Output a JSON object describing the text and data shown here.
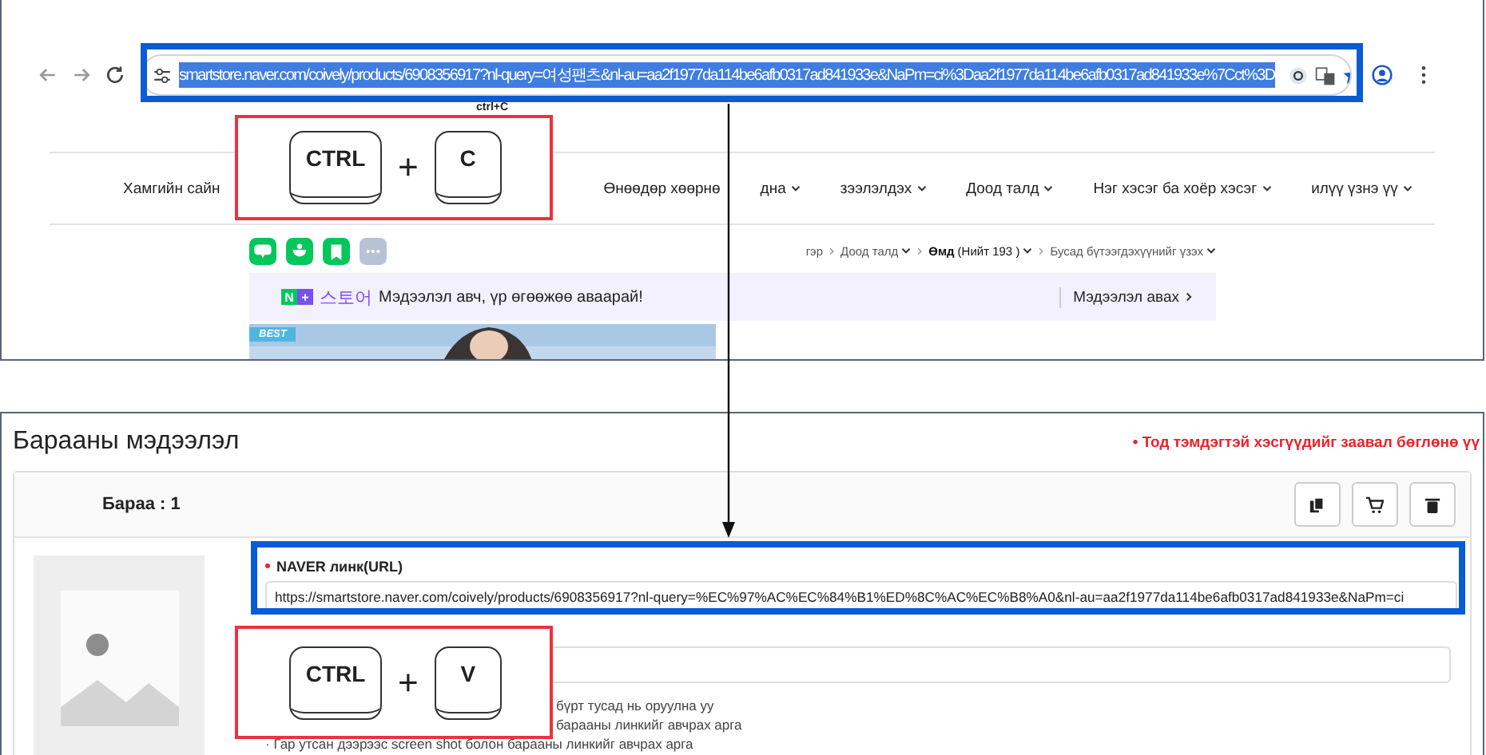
{
  "browser": {
    "address": "smartstore.naver.com/coively/products/6908356917?nl-query=여성팬츠&nl-au=aa2f1977da114be6afb0317ad841933e&NaPm=ci%3Daa2f1977da114be6afb0317ad841933e%7Cct%3D",
    "selected": true
  },
  "annotations": {
    "copy_hint": "ctrl+C",
    "copy_keys": [
      {
        "kind": "key",
        "label": "CTRL"
      },
      {
        "kind": "plus",
        "label": "+"
      },
      {
        "kind": "key",
        "label": "C"
      }
    ],
    "paste_keys": [
      {
        "kind": "key",
        "label": "CTRL"
      },
      {
        "kind": "plus",
        "label": "+"
      },
      {
        "kind": "key",
        "label": "V"
      }
    ]
  },
  "store_page": {
    "nav": [
      {
        "label": "Хамгийн сайн",
        "dropdown": false
      },
      {
        "label": "Өнөөдөр хөөрнө",
        "dropdown": false
      },
      {
        "label": "дна",
        "dropdown": true
      },
      {
        "label": "зээлэлдэх",
        "dropdown": true
      },
      {
        "label": "Доод талд",
        "dropdown": true
      },
      {
        "label": "Нэг хэсэг ба хоёр хэсэг",
        "dropdown": true
      },
      {
        "label": "илүү үзнэ үү",
        "dropdown": true
      }
    ],
    "breadcrumb": [
      {
        "label": "гэр",
        "selected": false,
        "dropdown": false
      },
      {
        "label": "Доод талд",
        "selected": false,
        "dropdown": true
      },
      {
        "label": "Өмд",
        "count": "(Нийт 193 )",
        "selected": true,
        "dropdown": true
      },
      {
        "label": "Бусад бүтээгдэхүүнийг үзэх",
        "selected": false,
        "dropdown": true
      }
    ],
    "banner": {
      "logo": [
        {
          "char": "N",
          "color": "#03c75a"
        },
        {
          "char": "+",
          "color": "#7b4ff0"
        }
      ],
      "store": "스토어",
      "message": "Мэдээлэл авч, үр өгөөжөө аваарай!",
      "link": "Мэдээлэл авах"
    },
    "photo": {
      "kind": "picture",
      "badge": "BEST"
    }
  },
  "form": {
    "title": "Барааны мэдээлэл",
    "required_note": "• Тод тэмдэгтэй хэсгүүдийг заавал бөглөнө үү",
    "item": {
      "title": "Бараа : 1",
      "fields": [
        {
          "kind": "labeled",
          "label": "NAVER линк(URL)",
          "required": true,
          "value": "https://smartstore.naver.com/coively/products/6908356917?nl-query=%EC%97%AC%EC%84%B1%ED%8C%AC%EC%B8%A0&nl-au=aa2f1977da114be6afb0317ad841933e&NaPm=ci"
        },
        {
          "kind": "input"
        }
      ],
      "notes": [
        {
          "text": "бүрт тусад нь оруулна уу",
          "covered": true
        },
        {
          "text": "барааны линкийг авчрах арга",
          "covered": true
        },
        {
          "text": "· Гар утсан дээрээс screen shot болон барааны линкийг авчрах арга",
          "covered": false
        }
      ]
    }
  }
}
